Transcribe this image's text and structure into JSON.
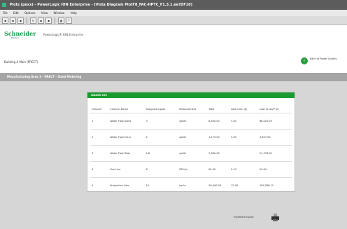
{
  "window": {
    "title": "Plots (pexx) - PowerLogic ION Enterprise - [Vista Diagram PlotF8_FAC-HPTC_F1.3.1.ee?DF10]"
  },
  "menu": {
    "items": [
      "File",
      "Edit",
      "Options",
      "View",
      "Window",
      "Help"
    ]
  },
  "header": {
    "logo_text": "Schneider",
    "logo_sub": "Electric",
    "app_title": "PowerLogic® ION Enterprise"
  },
  "building": {
    "label": "Building A Main (PRECT)"
  },
  "back_button": {
    "label": "Back to Power Quality"
  },
  "section": {
    "title": "Manufacturing Area 3 - PRECT - Sized Metering"
  },
  "panel": {
    "title": "WAGES-CEC",
    "columns": [
      "Channel",
      "Channel Name",
      "Assigned Inputs",
      "Measurement",
      "Total",
      "Last Chan (E)",
      "Cost To Go/P (E)"
    ],
    "rows": [
      [
        "1",
        "Water Flow Sales",
        "3",
        "gal/hr",
        "8,400.00",
        "3.00",
        "88,025.00"
      ],
      [
        "2",
        "Water Flow Entry",
        "4",
        "gal/hr",
        "1,179.00",
        "3.00",
        "3,857.00"
      ],
      [
        "3",
        "Water Flow Total",
        "5.6",
        "gal/hr",
        "9,980.00",
        "",
        "21,376.00"
      ],
      [
        "4",
        "Gas Line",
        "8",
        "BTU/hr",
        "64.00",
        "0.43",
        "29.64"
      ],
      [
        "5",
        "Production Line",
        "10",
        "kw hr",
        "26,490.00",
        "12.00",
        "109,288.21"
      ]
    ]
  },
  "export": {
    "label": "Excellent Export"
  }
}
